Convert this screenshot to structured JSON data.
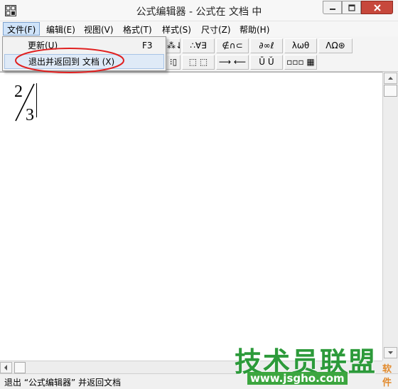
{
  "window": {
    "title": "公式编辑器 - 公式在 文档 中",
    "close_color": "#c7483c"
  },
  "menubar": {
    "items": [
      {
        "label": "文件(F)",
        "open": true
      },
      {
        "label": "编辑(E)"
      },
      {
        "label": "视图(V)"
      },
      {
        "label": "格式(T)"
      },
      {
        "label": "样式(S)"
      },
      {
        "label": "尺寸(Z)"
      },
      {
        "label": "帮助(H)"
      }
    ]
  },
  "file_menu": {
    "items": [
      {
        "label": "更新(U)",
        "shortcut": "F3"
      },
      {
        "label": "退出并返回到 文档 (X)",
        "highlighted": true
      }
    ]
  },
  "toolbar": {
    "row1": [
      "⁂↓",
      "∴∀∃",
      "∉∩⊂",
      "∂∞ℓ",
      "λωθ",
      "ΛΩ⊛"
    ],
    "row2": [
      "⁝▯",
      "⬚ ⬚",
      "⟶ ⟵",
      "Ū Ŭ",
      "▫▫▫ ▦"
    ]
  },
  "editor": {
    "fraction": {
      "numerator": "2",
      "denominator": "3"
    }
  },
  "statusbar": {
    "text": "退出 “公式编辑器” 并返回文档"
  },
  "watermark": {
    "brand": "技术员联盟",
    "url": "www.jsgho.com",
    "side": "软件网"
  },
  "annotation_color": "#e02020"
}
